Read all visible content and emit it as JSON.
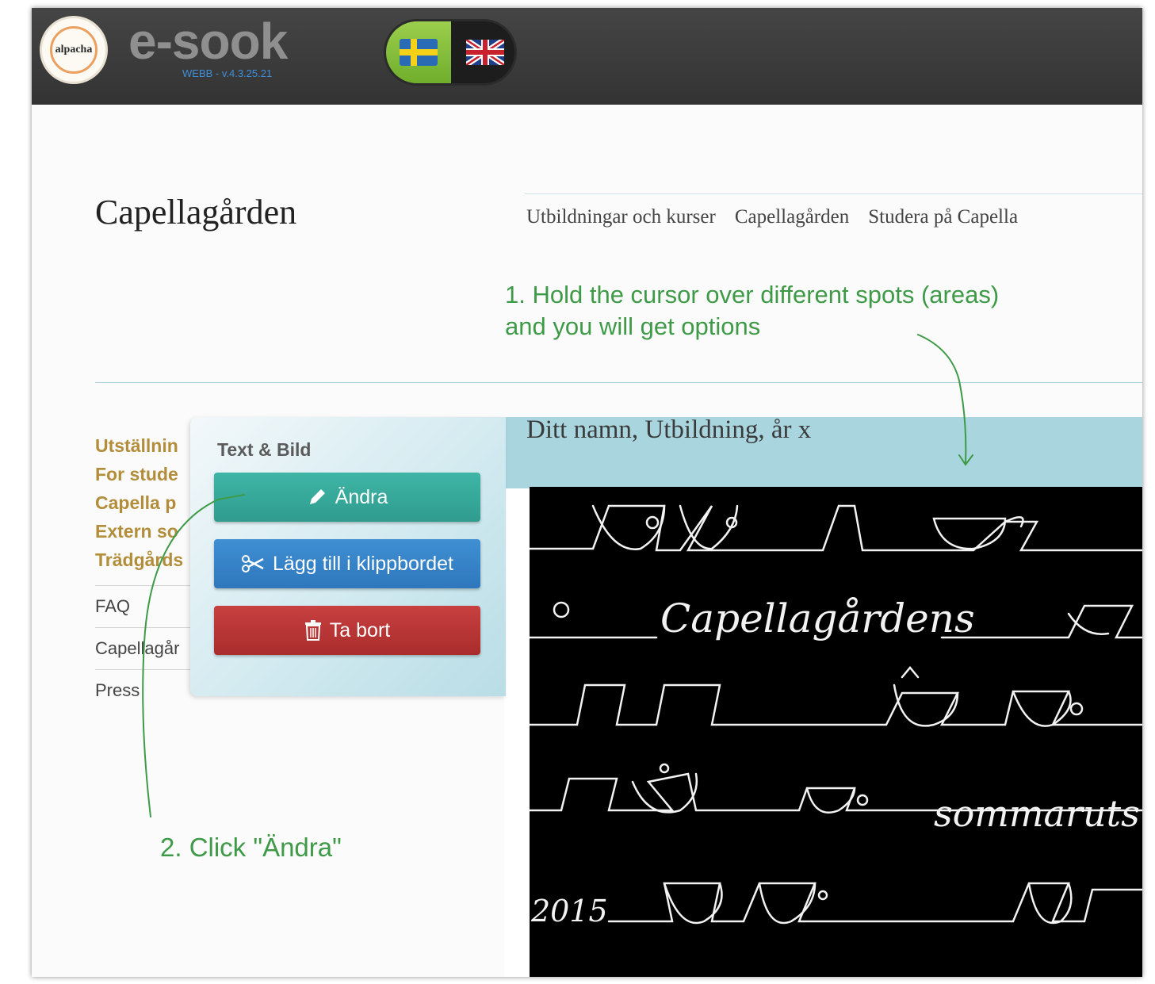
{
  "header": {
    "logo_text": "alpacha",
    "brand": "e-sook",
    "version": "WEBB - v.4.3.25.21",
    "languages": [
      "swedish-flag",
      "uk-flag"
    ]
  },
  "site": {
    "title": "Capellagården",
    "nav": [
      "Utbildningar och kurser",
      "Capellagården",
      "Studera på Capella"
    ]
  },
  "sidebar": {
    "gold_items": [
      "Utställnin",
      "For stude",
      "Capella p",
      "Extern so",
      "Trädgårds"
    ],
    "plain_items": [
      "FAQ",
      "Capellagår",
      "Press"
    ]
  },
  "content": {
    "caption": "Ditt namn, Utbildning, år x",
    "image_words": [
      "Capellagårdens",
      "sommaruts",
      "2015"
    ]
  },
  "popup": {
    "title": "Text & Bild",
    "edit_label": "Ändra",
    "clipboard_label": "Lägg till i klippbordet",
    "delete_label": "Ta bort"
  },
  "annotations": {
    "hint1": "1. Hold the cursor over different spots (areas) and you will get options",
    "hint2": "2. Click \"Ändra\""
  },
  "colors": {
    "topbar": "#3a3a3a",
    "hint": "#3f9a48",
    "sidebar_gold": "#b38d3a",
    "banner": "#a9d5df",
    "edit_button": "#35a596",
    "clip_button": "#3582c8",
    "delete_button": "#b83535"
  }
}
